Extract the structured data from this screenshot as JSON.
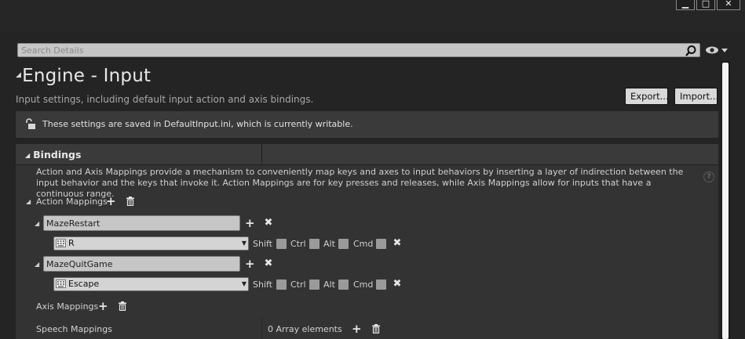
{
  "window": {
    "buttons": {
      "minimize": "▁",
      "maximize": "□",
      "close": "✕"
    }
  },
  "search": {
    "placeholder": "Search Details"
  },
  "header": {
    "title": "Engine - Input",
    "subtitle": "Input settings, including default input action and axis bindings.",
    "export_label": "Export...",
    "import_label": "Import..."
  },
  "notice": {
    "text": "These settings are saved in DefaultInput.ini, which is currently writable."
  },
  "bindings": {
    "label": "Bindings",
    "description": "Action and Axis Mappings provide a mechanism to conveniently map keys and axes to input behaviors by inserting a layer of indirection between the input behavior and the keys that invoke it. Action Mappings are for key presses and releases, while Axis Mappings allow for inputs that have a continuous range.",
    "help": "?",
    "action_mappings_label": "Action Mappings",
    "actions": [
      {
        "name": "MazeRestart",
        "key": "R"
      },
      {
        "name": "MazeQuitGame",
        "key": "Escape"
      }
    ],
    "modifiers": {
      "shift": "Shift",
      "ctrl": "Ctrl",
      "alt": "Alt",
      "cmd": "Cmd"
    },
    "axis_mappings_label": "Axis Mappings",
    "speech_mappings_label": "Speech Mappings",
    "speech_array_text": "0 Array elements"
  },
  "icons": {
    "add": "plus-icon",
    "delete": "trash-icon",
    "remove": "x-icon",
    "search": "search-icon",
    "visibility": "eye-icon",
    "lock": "lock-icon",
    "keyboard": "keyboard-icon"
  },
  "colors": {
    "background": "#242424",
    "panel": "#333333",
    "header": "#3a3a3a",
    "field": "#c6c6c6"
  }
}
